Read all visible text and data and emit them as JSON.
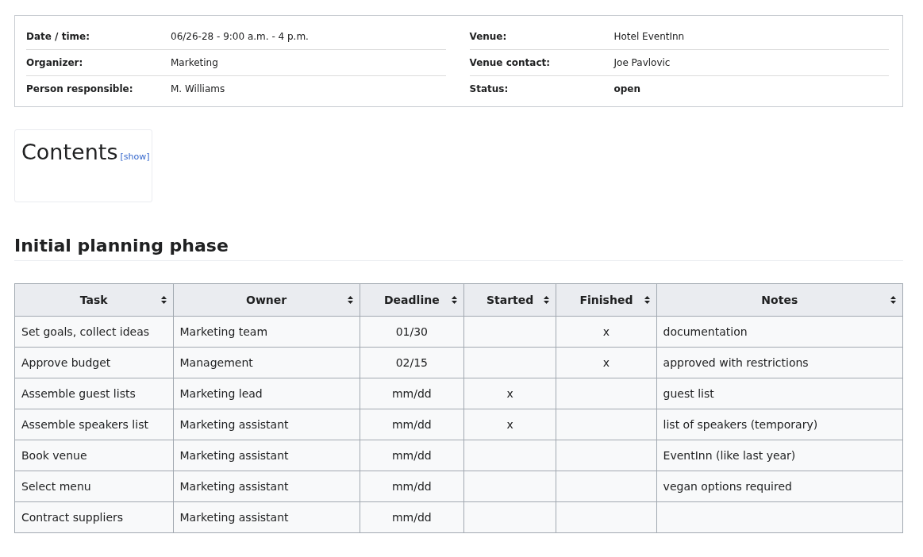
{
  "info": {
    "left": [
      {
        "label": "Date / time:",
        "value": "06/26-28 - 9:00 a.m. - 4 p.m.",
        "bold": false
      },
      {
        "label": "Organizer:",
        "value": "Marketing",
        "bold": false
      },
      {
        "label": "Person responsible:",
        "value": "M. Williams",
        "bold": false
      }
    ],
    "right": [
      {
        "label": "Venue:",
        "value": "Hotel EventInn",
        "bold": false
      },
      {
        "label": "Venue contact:",
        "value": "Joe Pavlovic",
        "bold": false
      },
      {
        "label": "Status:",
        "value": "open",
        "bold": true
      }
    ]
  },
  "contents": {
    "title": "Contents",
    "toggle": "[show]"
  },
  "section": {
    "heading": "Initial planning phase"
  },
  "table": {
    "columns": [
      "Task",
      "Owner",
      "Deadline",
      "Started",
      "Finished",
      "Notes"
    ],
    "rows": [
      [
        "Set goals, collect ideas",
        "Marketing team",
        "01/30",
        "",
        "x",
        "documentation"
      ],
      [
        "Approve budget",
        "Management",
        "02/15",
        "",
        "x",
        "approved with restrictions"
      ],
      [
        "Assemble guest lists",
        "Marketing lead",
        "mm/dd",
        "x",
        "",
        "guest list"
      ],
      [
        "Assemble speakers list",
        "Marketing assistant",
        "mm/dd",
        "x",
        "",
        "list of speakers (temporary)"
      ],
      [
        "Book venue",
        "Marketing assistant",
        "mm/dd",
        "",
        "",
        "EventInn (like last year)"
      ],
      [
        "Select menu",
        "Marketing assistant",
        "mm/dd",
        "",
        "",
        "vegan options required"
      ],
      [
        "Contract suppliers",
        "Marketing assistant",
        "mm/dd",
        "",
        "",
        ""
      ]
    ]
  }
}
